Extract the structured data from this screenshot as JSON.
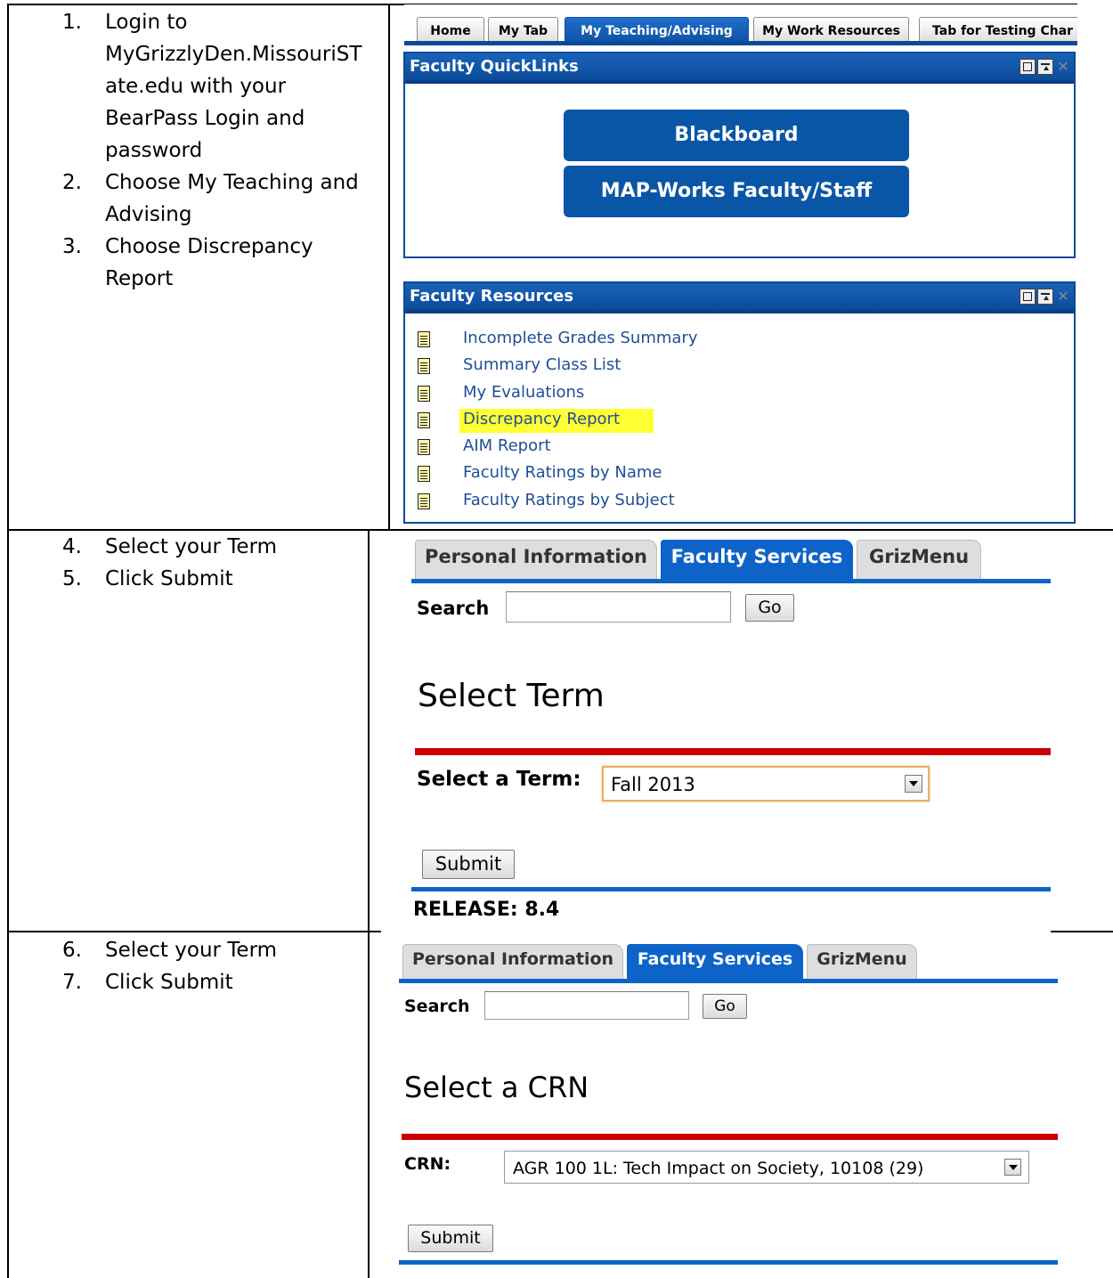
{
  "section1": {
    "steps": [
      {
        "num": "1.",
        "lines": [
          "Login to",
          "MyGrizzlyDen.MissouriST",
          "ate.edu with your",
          "BearPass Login and",
          "password"
        ]
      },
      {
        "num": "2.",
        "lines": [
          "Choose My Teaching and",
          "Advising"
        ]
      },
      {
        "num": "3.",
        "lines": [
          "Choose Discrepancy",
          "Report"
        ]
      }
    ],
    "tabs": [
      "Home",
      "My Tab",
      "My Teaching/Advising",
      "My Work Resources",
      "Tab for Testing Char"
    ],
    "quicklinks": {
      "title": "Faculty QuickLinks",
      "buttons": [
        "Blackboard",
        "MAP-Works Faculty/Staff"
      ]
    },
    "resources": {
      "title": "Faculty Resources",
      "links": [
        "Incomplete Grades Summary",
        "Summary Class List",
        "My Evaluations",
        "Discrepancy Report",
        "AIM Report",
        "Faculty Ratings by Name",
        "Faculty Ratings by Subject"
      ]
    }
  },
  "section2": {
    "steps": [
      {
        "num": "4.",
        "text": "Select your Term"
      },
      {
        "num": "5.",
        "text": "Click Submit"
      }
    ],
    "tabs": [
      "Personal Information",
      "Faculty Services",
      "GrizMenu"
    ],
    "search_label": "Search",
    "search_value": "",
    "go_label": "Go",
    "title": "Select Term",
    "term_label": "Select a Term:",
    "term_value": "Fall 2013",
    "submit_label": "Submit",
    "release": "RELEASE: 8.4"
  },
  "section3": {
    "steps": [
      {
        "num": "6.",
        "text": "Select your Term"
      },
      {
        "num": "7.",
        "text": "Click Submit"
      }
    ],
    "tabs": [
      "Personal Information",
      "Faculty Services",
      "GrizMenu"
    ],
    "search_label": "Search",
    "search_value": "",
    "go_label": "Go",
    "title": "Select a CRN",
    "crn_label": "CRN:",
    "crn_value": "AGR 100 1L: Tech Impact on Society, 10108 (29)",
    "submit_label": "Submit"
  },
  "colors": {
    "banner_blue": "#0d63c8",
    "portal_blue": "#0a4a9a",
    "red_rule": "#cc0000",
    "highlight": "#ffff33"
  }
}
